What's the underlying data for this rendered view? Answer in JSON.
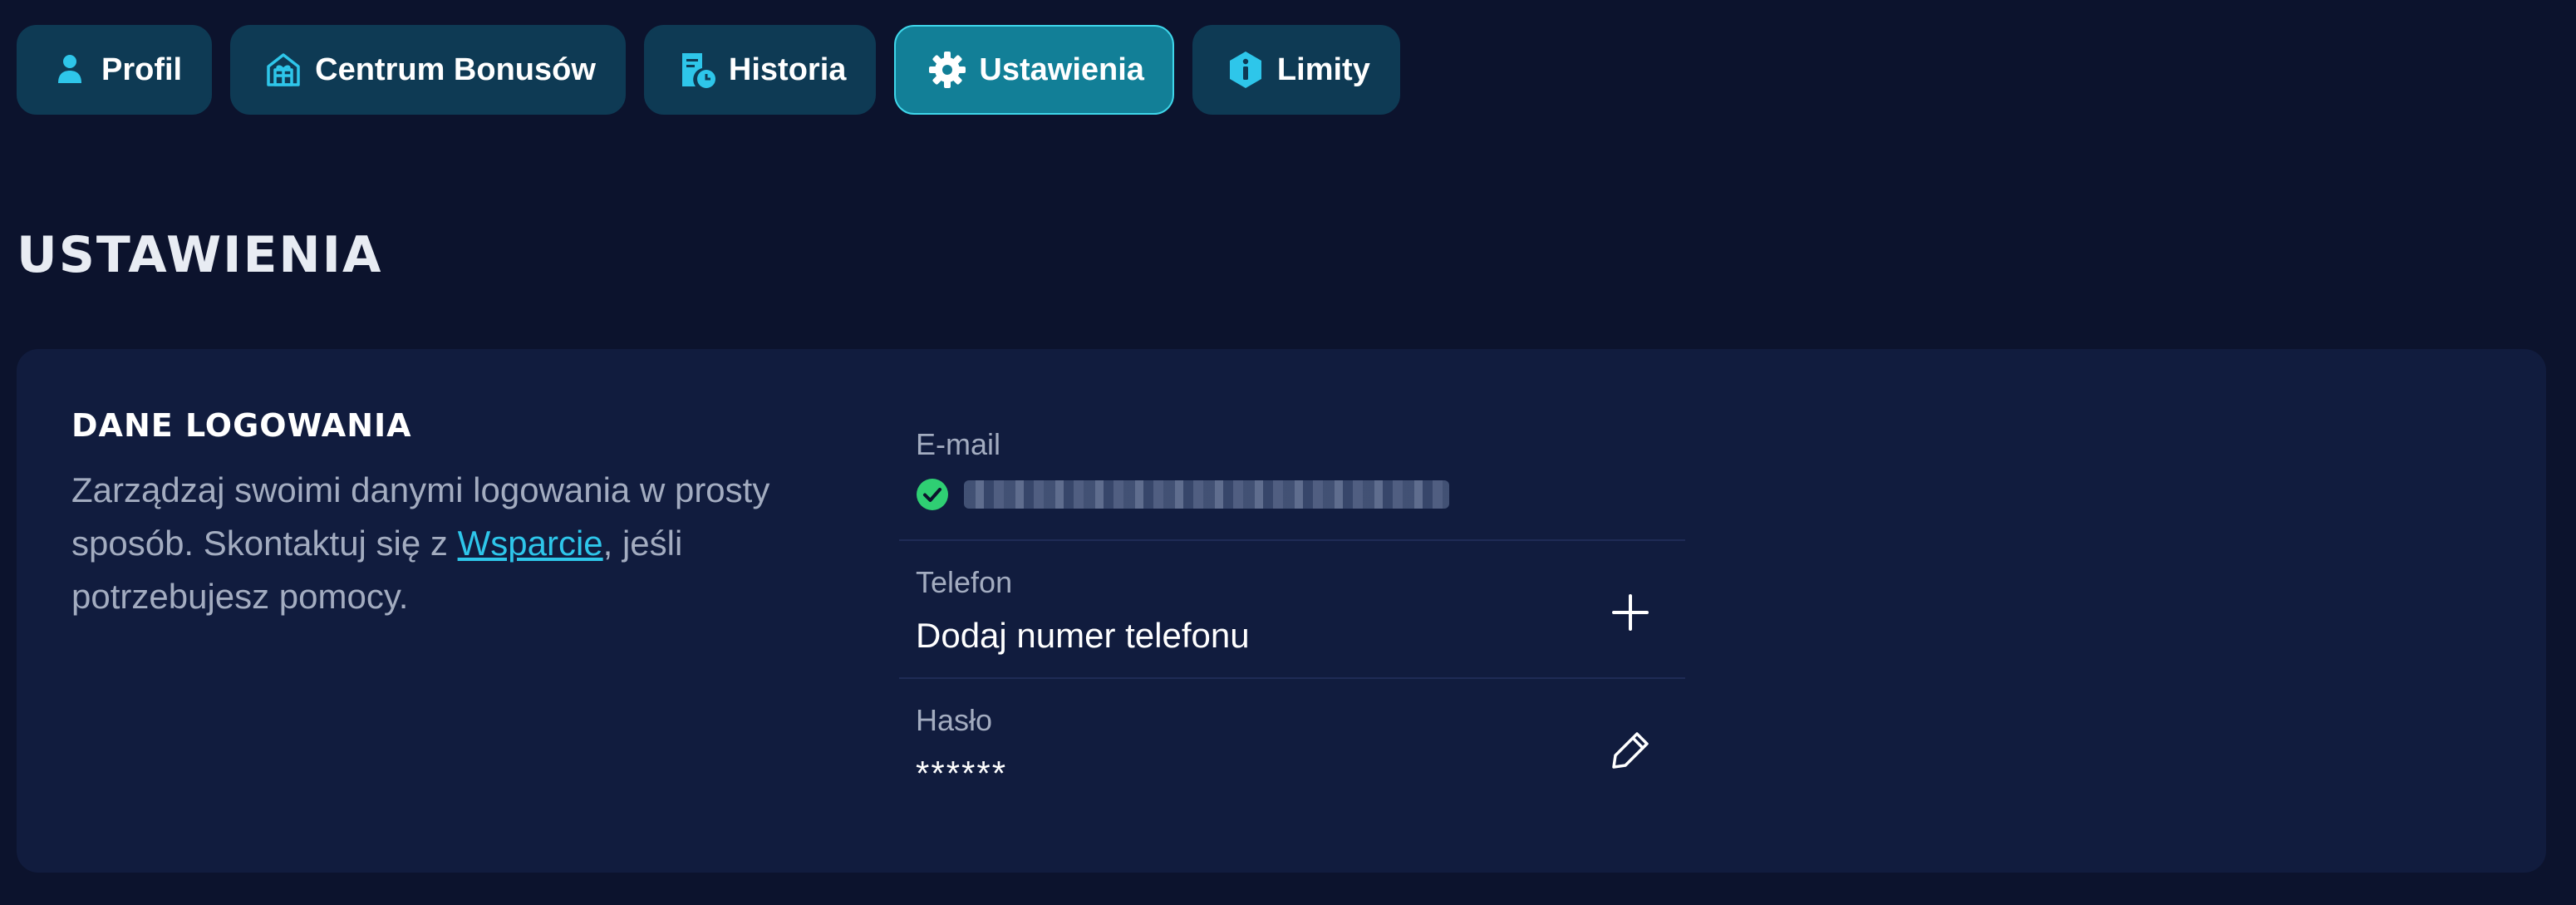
{
  "colors": {
    "background": "#0c132d",
    "card": "#111c3e",
    "tab": "#0e3a54",
    "tab_active": "#127f97",
    "accent": "#2ec6ea",
    "verified": "#2fcf73"
  },
  "tabs": [
    {
      "label": "Profil",
      "icon": "user-icon",
      "active": false
    },
    {
      "label": "Centrum Bonusów",
      "icon": "gift-house-icon",
      "active": false
    },
    {
      "label": "Historia",
      "icon": "document-clock-icon",
      "active": false
    },
    {
      "label": "Ustawienia",
      "icon": "gear-icon",
      "active": true
    },
    {
      "label": "Limity",
      "icon": "info-hexagon-icon",
      "active": false
    }
  ],
  "page": {
    "title": "USTAWIENIA"
  },
  "login_section": {
    "title": "DANE LOGOWANIA",
    "description_before": "Zarządzaj swoimi danymi logowania w prosty sposób. Skontaktuj się z ",
    "support_link": "Wsparcie",
    "description_after": ", jeśli potrzebujesz pomocy.",
    "email": {
      "label": "E-mail",
      "value": "redacted@gmail.com",
      "verified_icon": "check-circle-icon"
    },
    "phone": {
      "label": "Telefon",
      "value": "Dodaj numer telefonu",
      "action_icon": "plus-icon"
    },
    "password": {
      "label": "Hasło",
      "value": "******",
      "action_icon": "pencil-icon"
    }
  }
}
